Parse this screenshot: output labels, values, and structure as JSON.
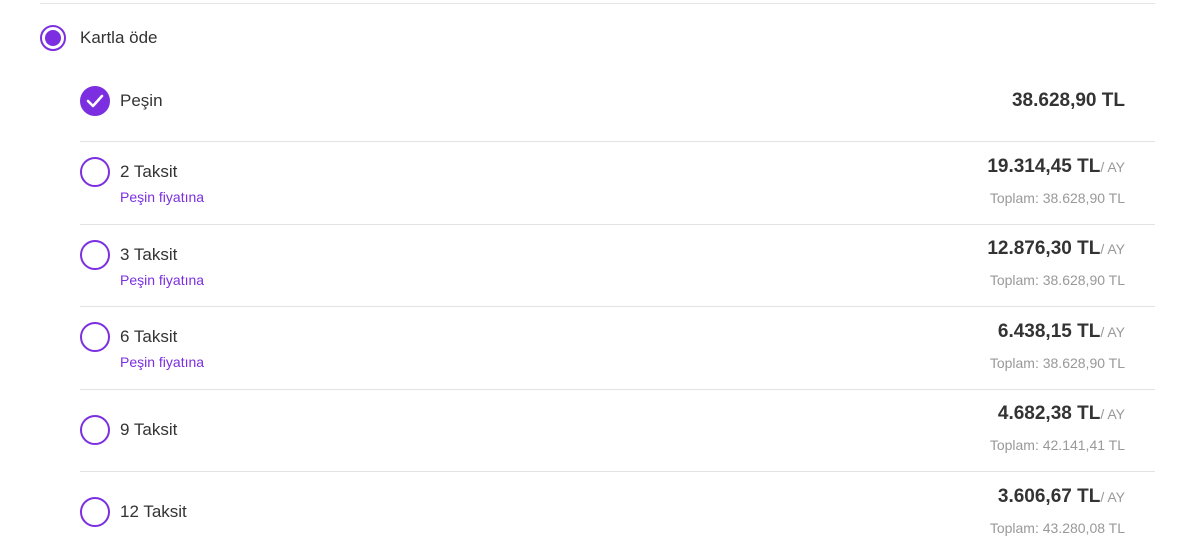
{
  "payment_method": {
    "label": "Kartla öde",
    "selected": true
  },
  "plans": [
    {
      "name": "Peşin",
      "price": "38.628,90 TL",
      "selected": true
    },
    {
      "name": "2 Taksit",
      "note": "Peşin fiyatına",
      "price": "19.314,45 TL",
      "unit": "/ AY",
      "total": "Toplam: 38.628,90 TL",
      "selected": false
    },
    {
      "name": "3 Taksit",
      "note": "Peşin fiyatına",
      "price": "12.876,30 TL",
      "unit": "/ AY",
      "total": "Toplam: 38.628,90 TL",
      "selected": false
    },
    {
      "name": "6 Taksit",
      "note": "Peşin fiyatına",
      "price": "6.438,15 TL",
      "unit": "/ AY",
      "total": "Toplam: 38.628,90 TL",
      "selected": false
    },
    {
      "name": "9 Taksit",
      "price": "4.682,38 TL",
      "unit": "/ AY",
      "total": "Toplam: 42.141,41 TL",
      "selected": false
    },
    {
      "name": "12 Taksit",
      "price": "3.606,67 TL",
      "unit": "/ AY",
      "total": "Toplam: 43.280,08 TL",
      "selected": false
    }
  ],
  "colors": {
    "accent": "#7b2fe0",
    "text": "#333333",
    "muted": "#999999",
    "divider": "#e3e3e3"
  }
}
